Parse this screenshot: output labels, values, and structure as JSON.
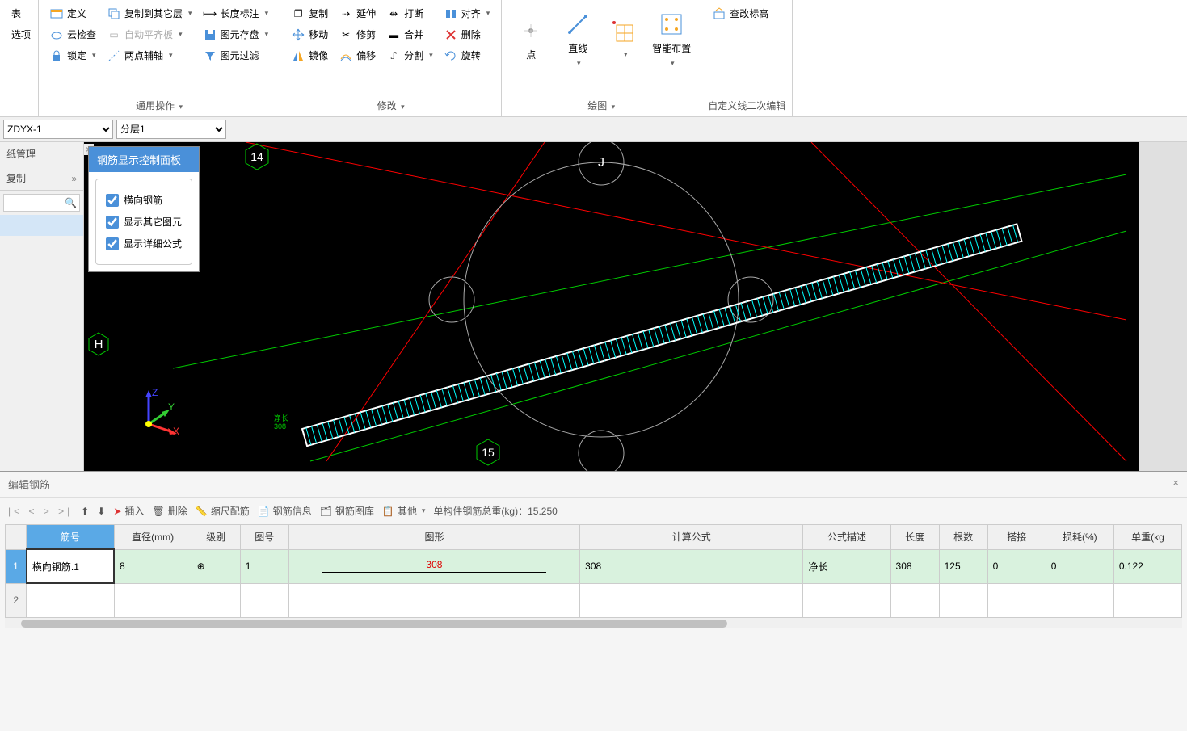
{
  "ribbon": {
    "group1": {
      "items": [
        "表",
        "选项"
      ]
    },
    "group_common": {
      "label": "通用操作",
      "col1": [
        "定义",
        "云检查",
        "锁定"
      ],
      "col2": [
        "复制到其它层",
        "自动平齐板",
        "两点辅轴"
      ],
      "col3": [
        "长度标注",
        "图元存盘",
        "图元过滤"
      ]
    },
    "group_modify": {
      "label": "修改",
      "col1": [
        "复制",
        "移动",
        "镜像"
      ],
      "col2": [
        "延伸",
        "修剪",
        "偏移"
      ],
      "col3": [
        "打断",
        "合并",
        "分割"
      ],
      "col4": [
        "对齐",
        "删除",
        "旋转"
      ]
    },
    "group_draw": {
      "label": "绘图",
      "items": [
        "点",
        "直线",
        "",
        "智能布置"
      ]
    },
    "group_custom": {
      "label": "自定义线二次编辑",
      "items": [
        "查改标高"
      ]
    }
  },
  "dropdowns": {
    "component": "ZDYX-1",
    "layer": "分层1"
  },
  "left_panel": {
    "tab1": "纸管理",
    "tab2": "复制",
    "search_placeholder": ""
  },
  "control_panel": {
    "title": "钢筋显示控制面板",
    "opt1": "横向钢筋",
    "opt2": "显示其它图元",
    "opt3": "显示详细公式"
  },
  "viewport": {
    "label_j": "J",
    "label_h": "H",
    "label_14": "14",
    "label_15": "15",
    "net_len_label": "净长",
    "net_len_val": "308",
    "view_2d": "2D"
  },
  "bottom": {
    "title": "编辑钢筋",
    "toolbar": {
      "insert": "插入",
      "delete": "删除",
      "scale": "缩尺配筋",
      "info": "钢筋信息",
      "library": "钢筋图库",
      "other": "其他",
      "total_label": "单构件钢筋总重(kg)：",
      "total_value": "15.250"
    },
    "headers": [
      "筋号",
      "直径(mm)",
      "级别",
      "图号",
      "图形",
      "计算公式",
      "公式描述",
      "长度",
      "根数",
      "搭接",
      "损耗(%)",
      "单重(kg"
    ],
    "row1": {
      "name": "横向钢筋.1",
      "diameter": "8",
      "grade": "⊕",
      "shape_no": "1",
      "shape_val": "308",
      "formula": "308",
      "desc": "净长",
      "length": "308",
      "count": "125",
      "overlap": "0",
      "loss": "0",
      "weight": "0.122"
    },
    "row2_num": "2"
  }
}
